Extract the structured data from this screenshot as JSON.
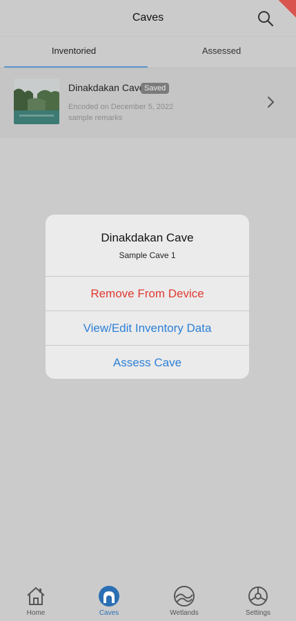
{
  "header": {
    "title": "Caves",
    "search_icon": "search-icon"
  },
  "tabs": [
    {
      "label": "Inventoried",
      "selected": true
    },
    {
      "label": "Assessed",
      "selected": false
    }
  ],
  "cave_list": [
    {
      "name": "Dinakdakan Cave",
      "badge": "Saved",
      "encoded": "Encoded on December 5, 2022",
      "remarks": "sample remarks"
    }
  ],
  "dialog": {
    "title": "Dinakdakan Cave",
    "subtitle": "Sample Cave 1",
    "actions": [
      {
        "label": "Remove From Device",
        "color": "#e03a32"
      },
      {
        "label": "View/Edit Inventory Data",
        "color": "#2c7fd6"
      },
      {
        "label": "Assess Cave",
        "color": "#2c7fd6"
      }
    ]
  },
  "bottom_nav": [
    {
      "label": "Home",
      "icon": "home-icon",
      "active": false
    },
    {
      "label": "Caves",
      "icon": "cave-icon",
      "active": true
    },
    {
      "label": "Wetlands",
      "icon": "wetlands-icon",
      "active": false
    },
    {
      "label": "Settings",
      "icon": "settings-icon",
      "active": false
    }
  ],
  "colors": {
    "accent": "#2a6fb3",
    "destructive": "#e03a32",
    "tab_indicator": "#5b93cf"
  }
}
